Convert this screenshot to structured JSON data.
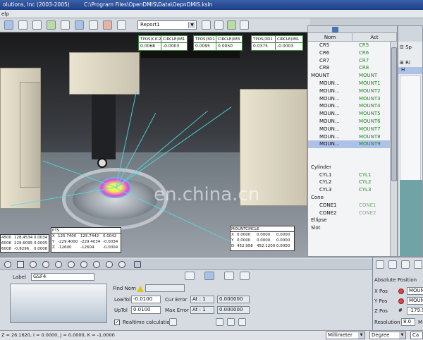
{
  "window": {
    "title_left": "olutions, Inc (2003-2005)",
    "title_path": "C:\\Program Files\\OpenDMIS\\Data\\OepnDMIS.ksln"
  },
  "menubar": {
    "help": "elp"
  },
  "toolbar": {
    "report_select": "Report1"
  },
  "viewport": {
    "watermark": "en.china.cn",
    "point_boxes": [
      {
        "header": "TPOS(CIC2",
        "value": "0.0068"
      },
      {
        "header": "CIRCLE(IM1",
        "value": "-0.0003"
      },
      {
        "header": "TPOS(3D1",
        "value": "0.0095"
      },
      {
        "header": "CIRCLE(IM3",
        "value": "0.0050"
      },
      {
        "header": "TPOS(3D1",
        "value": "0.0375"
      },
      {
        "header": "CIRCLE(IM1",
        "value": "-0.0003"
      }
    ],
    "table_left": {
      "rows": [
        [
          "4500",
          "128.4534",
          "0.0034"
        ],
        [
          "6006",
          "229.6095",
          "0.0005"
        ],
        [
          "6008",
          "-0.8296",
          "0.0008"
        ]
      ]
    },
    "table_pts": {
      "header": "PTS",
      "rows": [
        [
          "X",
          "125.7400",
          "125.7442",
          "0.0042"
        ],
        [
          "Y",
          "-229.4000",
          "-229.4034",
          "-0.0034"
        ],
        [
          "Z",
          "-12600",
          "-12604",
          "-0.0004"
        ]
      ]
    },
    "table_mount": {
      "header": "MOUNTCIRCLE",
      "rows": [
        [
          "X",
          "0.0000",
          "0.0000",
          "0.0000"
        ],
        [
          "Y",
          "0.0000",
          "0.0000",
          "0.0000"
        ],
        [
          "D",
          "452.958",
          "452.1200",
          "0.0000"
        ]
      ]
    }
  },
  "feature_tree": {
    "col_nom": "Nom",
    "col_act": "Act",
    "rows": [
      {
        "nom": "CR5",
        "act": "CR5",
        "kind": "ind"
      },
      {
        "nom": "CR6",
        "act": "CR6",
        "kind": "ind"
      },
      {
        "nom": "CR7",
        "act": "CR7",
        "kind": "ind"
      },
      {
        "nom": "CR8",
        "act": "CR8",
        "kind": "ind"
      },
      {
        "nom": "MOUNT",
        "act": "MOUNT",
        "kind": "grp"
      },
      {
        "nom": "MOUN...",
        "act": "MOUNT1",
        "kind": "ind"
      },
      {
        "nom": "MOUN...",
        "act": "MOUNT2",
        "kind": "ind"
      },
      {
        "nom": "MOUN...",
        "act": "MOUNT3",
        "kind": "ind"
      },
      {
        "nom": "MOUN...",
        "act": "MOUNT4",
        "kind": "ind"
      },
      {
        "nom": "MOUN...",
        "act": "MOUNT5",
        "kind": "ind"
      },
      {
        "nom": "MOUN...",
        "act": "MOUNT6",
        "kind": "ind"
      },
      {
        "nom": "MOUN...",
        "act": "MOUNT7",
        "kind": "ind"
      },
      {
        "nom": "MOUN...",
        "act": "MOUNT8",
        "kind": "ind"
      },
      {
        "nom": "MOUN...",
        "act": "MOUNT9",
        "kind": "sel"
      },
      {
        "nom": "",
        "act": "",
        "kind": "blank"
      },
      {
        "nom": "",
        "act": "",
        "kind": "blank"
      },
      {
        "nom": "Cylinder",
        "act": "",
        "kind": "grp"
      },
      {
        "nom": "CYL1",
        "act": "CYL1",
        "kind": "ind"
      },
      {
        "nom": "CYL2",
        "act": "CYL2",
        "kind": "ind"
      },
      {
        "nom": "CYL3",
        "act": "CYL3",
        "kind": "ind"
      },
      {
        "nom": "Cone",
        "act": "",
        "kind": "grp"
      },
      {
        "nom": "CONE1",
        "act": "CONE1",
        "kind": "gray"
      },
      {
        "nom": "CONE2",
        "act": "CONE2",
        "kind": "gray"
      },
      {
        "nom": "Ellipse",
        "act": "",
        "kind": "grp"
      },
      {
        "nom": "Slot",
        "act": "",
        "kind": "grp"
      }
    ]
  },
  "far_right": {
    "item1": "Sp",
    "item2": "Ri",
    "item3": "H"
  },
  "bottom": {
    "label_caption": "Label",
    "label_value": "GSF4",
    "find_nom_label": "Find Nom",
    "low_tol_label": "LowTol",
    "low_tol_value": "-0.0100",
    "up_tol_label": "UpTol",
    "up_tol_value": "0.0100",
    "cur_error_label": "Cur Error",
    "at_label_1": "At : 1",
    "cur_error_value": "0.000000",
    "max_error_label": "Max Error",
    "at_label_2": "At : 1",
    "max_error_value": "0.000000",
    "realtime_label": "Realtime calculation"
  },
  "position_panel": {
    "title": "Absolute Position",
    "x_label": "X Pos",
    "x_value": "MOUNT",
    "y_label": "Y Pos",
    "y_value": "MOUNT",
    "z_label": "Z Pos",
    "z_value": "-179.9",
    "resolution_label": "Resolution",
    "resolution_value": "8.0",
    "m_label": "M"
  },
  "statusbar": {
    "coords": "Z = 26.1620, I = 0.0000, J = 0.0000, K = -1.0000",
    "units": "Millimeter",
    "angle": "Degree",
    "extra": "Ca"
  }
}
